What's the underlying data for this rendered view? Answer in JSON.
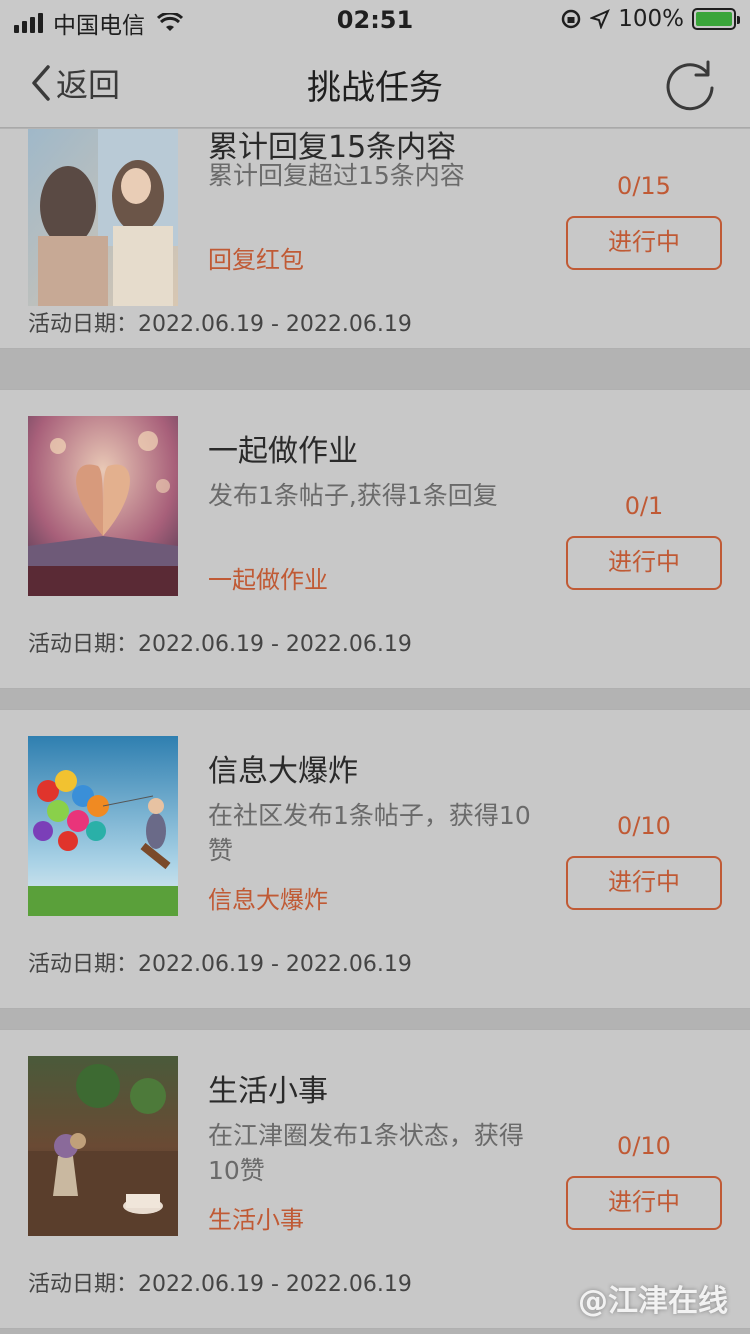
{
  "status_bar": {
    "carrier": "中国电信",
    "time": "02:51",
    "battery": "100%",
    "battery_level": 1.0
  },
  "nav": {
    "back_label": "返回",
    "title": "挑战任务"
  },
  "tasks": [
    {
      "title": "累计回复15条内容",
      "desc": "累计回复超过15条内容",
      "reward": "回复红包",
      "progress": "0/15",
      "status": "进行中",
      "date_label": "活动日期：",
      "date_range": "2022.06.19 - 2022.06.19"
    },
    {
      "title": "一起做作业",
      "desc": "发布1条帖子,获得1条回复",
      "reward": "一起做作业",
      "progress": "0/1",
      "status": "进行中",
      "date_label": "活动日期：",
      "date_range": "2022.06.19 - 2022.06.19"
    },
    {
      "title": "信息大爆炸",
      "desc": "在社区发布1条帖子，获得10赞",
      "reward": "信息大爆炸",
      "progress": "0/10",
      "status": "进行中",
      "date_label": "活动日期：",
      "date_range": "2022.06.19 - 2022.06.19"
    },
    {
      "title": "生活小事",
      "desc": "在江津圈发布1条状态，获得10赞",
      "reward": "生活小事",
      "progress": "0/10",
      "status": "进行中",
      "date_label": "活动日期：",
      "date_range": "2022.06.19 - 2022.06.19"
    }
  ],
  "watermark": "@江津在线",
  "colors": {
    "accent": "#c05a35",
    "background": "#b3b3b3",
    "card": "#c8c8c8"
  }
}
